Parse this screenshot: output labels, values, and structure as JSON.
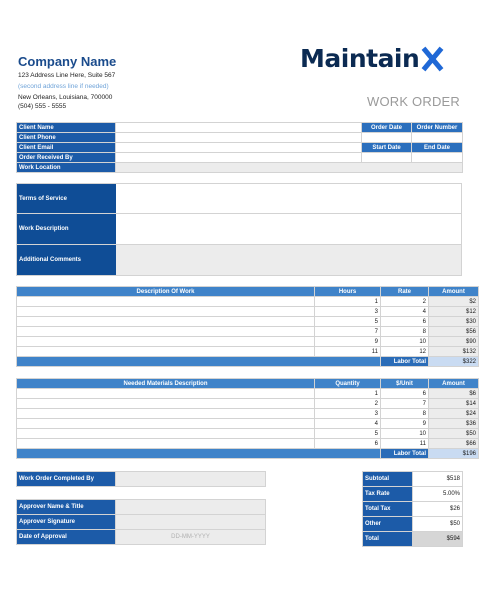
{
  "company": {
    "name": "Company Name",
    "address1": "123 Address Line Here, Suite 567",
    "address2": "(second address line if needed)",
    "city": "New Orleans, Louisiana, 700000",
    "phone": "(504) 555 - 5555"
  },
  "logo": {
    "text": "Maintain"
  },
  "doc_title": "WORK ORDER",
  "client": {
    "labels": [
      "Client Name",
      "Client Phone",
      "Client Email",
      "Order Received By",
      "Work Location"
    ],
    "order_date_label": "Order Date",
    "order_number_label": "Order Number",
    "start_date_label": "Start Date",
    "end_date_label": "End Date"
  },
  "info": {
    "terms_label": "Terms of Service",
    "description_label": "Work Description",
    "comments_label": "Additional Comments"
  },
  "labor": {
    "headers": [
      "Description Of Work",
      "Hours",
      "Rate",
      "Amount"
    ],
    "rows": [
      {
        "hours": "1",
        "rate": "2",
        "amount": "$2"
      },
      {
        "hours": "3",
        "rate": "4",
        "amount": "$12"
      },
      {
        "hours": "5",
        "rate": "6",
        "amount": "$30"
      },
      {
        "hours": "7",
        "rate": "8",
        "amount": "$56"
      },
      {
        "hours": "9",
        "rate": "10",
        "amount": "$90"
      },
      {
        "hours": "11",
        "rate": "12",
        "amount": "$132"
      }
    ],
    "total_label": "Labor Total",
    "total_value": "$322"
  },
  "materials": {
    "headers": [
      "Needed Materials Description",
      "Quantity",
      "$/Unit",
      "Amount"
    ],
    "rows": [
      {
        "qty": "1",
        "unit": "6",
        "amount": "$6"
      },
      {
        "qty": "2",
        "unit": "7",
        "amount": "$14"
      },
      {
        "qty": "3",
        "unit": "8",
        "amount": "$24"
      },
      {
        "qty": "4",
        "unit": "9",
        "amount": "$36"
      },
      {
        "qty": "5",
        "unit": "10",
        "amount": "$50"
      },
      {
        "qty": "6",
        "unit": "11",
        "amount": "$66"
      }
    ],
    "total_label": "Labor Total",
    "total_value": "$196"
  },
  "completion": {
    "completed_by_label": "Work Order Completed By",
    "approver_name_label": "Approver Name & Title",
    "approver_signature_label": "Approver Signature",
    "approval_date_label": "Date of Approval",
    "date_placeholder": "DD-MM-YYYY"
  },
  "summary": {
    "subtotal_label": "Subtotal",
    "subtotal": "$518",
    "tax_rate_label": "Tax Rate",
    "tax_rate": "5.00%",
    "total_tax_label": "Total Tax",
    "total_tax": "$26",
    "other_label": "Other",
    "other": "$50",
    "total_label": "Total",
    "total": "$594"
  }
}
